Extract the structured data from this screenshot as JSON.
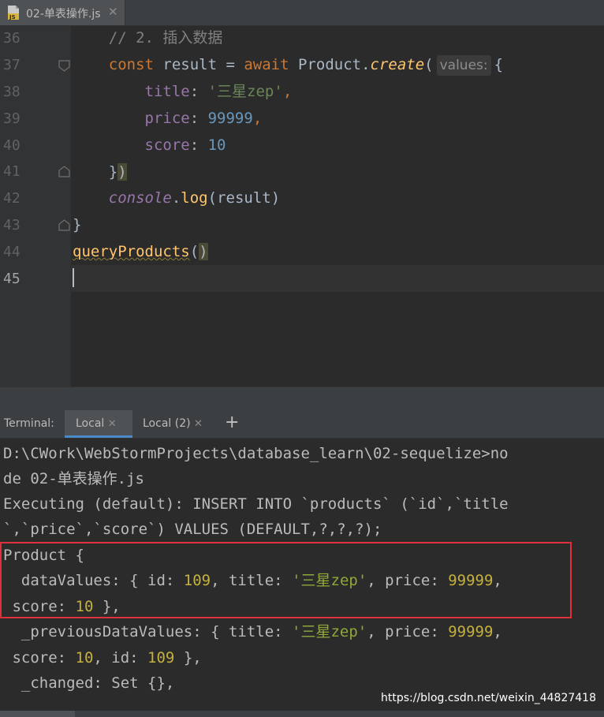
{
  "tab": {
    "title": "02-单表操作.js",
    "close": "✕",
    "icon_badge": "JS"
  },
  "editor": {
    "lines": [
      {
        "num": "36"
      },
      {
        "num": "37"
      },
      {
        "num": "38"
      },
      {
        "num": "39"
      },
      {
        "num": "40"
      },
      {
        "num": "41"
      },
      {
        "num": "42"
      },
      {
        "num": "43"
      },
      {
        "num": "44"
      },
      {
        "num": "45"
      }
    ],
    "code": {
      "l36": "// 2. 插入数据",
      "l37_kw1": "const",
      "l37_var": " result = ",
      "l37_kw2": "await",
      "l37_obj": " Product.",
      "l37_fn": "create",
      "l37_paren": "(",
      "l37_hint": "values:",
      "l37_brace": "{",
      "l38_key": "title",
      "l38_colon": ": ",
      "l38_val": "'三星zep'",
      "l38_comma": ",",
      "l39_key": "price",
      "l39_colon": ": ",
      "l39_val": "99999",
      "l39_comma": ",",
      "l40_key": "score",
      "l40_colon": ": ",
      "l40_val": "10",
      "l41_brace": "}",
      "l41_paren": ")",
      "l42_obj": "console",
      "l42_dot": ".",
      "l42_fn": "log",
      "l42_args": "(result)",
      "l43": "}",
      "l44_fn": "queryProducts",
      "l44_open": "(",
      "l44_close": ")"
    }
  },
  "terminal_bar": {
    "label": "Terminal:",
    "tabs": [
      {
        "label": "Local",
        "close": "✕"
      },
      {
        "label": "Local (2)",
        "close": "✕"
      }
    ],
    "add": "+"
  },
  "terminal": {
    "l1": "D:\\CWork\\WebStormProjects\\database_learn\\02-sequelize>no",
    "l2": "de 02-单表操作.js",
    "l3": "Executing (default): INSERT INTO `products` (`id`,`title",
    "l4": "`,`price`,`score`) VALUES (DEFAULT,?,?,?);",
    "l5": "Product {",
    "l6_a": "  dataValues: { id: ",
    "l6_id": "109",
    "l6_b": ", title: ",
    "l6_title": "'三星zep'",
    "l6_c": ", price: ",
    "l6_price": "99999",
    "l6_d": ",",
    "l7_a": " score: ",
    "l7_score": "10",
    "l7_b": " },",
    "l8_a": "  _previousDataValues: { title: ",
    "l8_title": "'三星zep'",
    "l8_b": ", price: ",
    "l8_price": "99999",
    "l8_c": ",",
    "l9_a": " score: ",
    "l9_score": "10",
    "l9_b": ", id: ",
    "l9_id": "109",
    "l9_c": " },",
    "l10": "  _changed: Set {},"
  },
  "watermark": "https://blog.csdn.net/weixin_44827418",
  "colors": {
    "keyword": "#cc7832",
    "function": "#ffc66d",
    "property": "#9876aa",
    "string": "#6a8759",
    "number": "#6897bb",
    "highlight_box": "#e0303a"
  }
}
